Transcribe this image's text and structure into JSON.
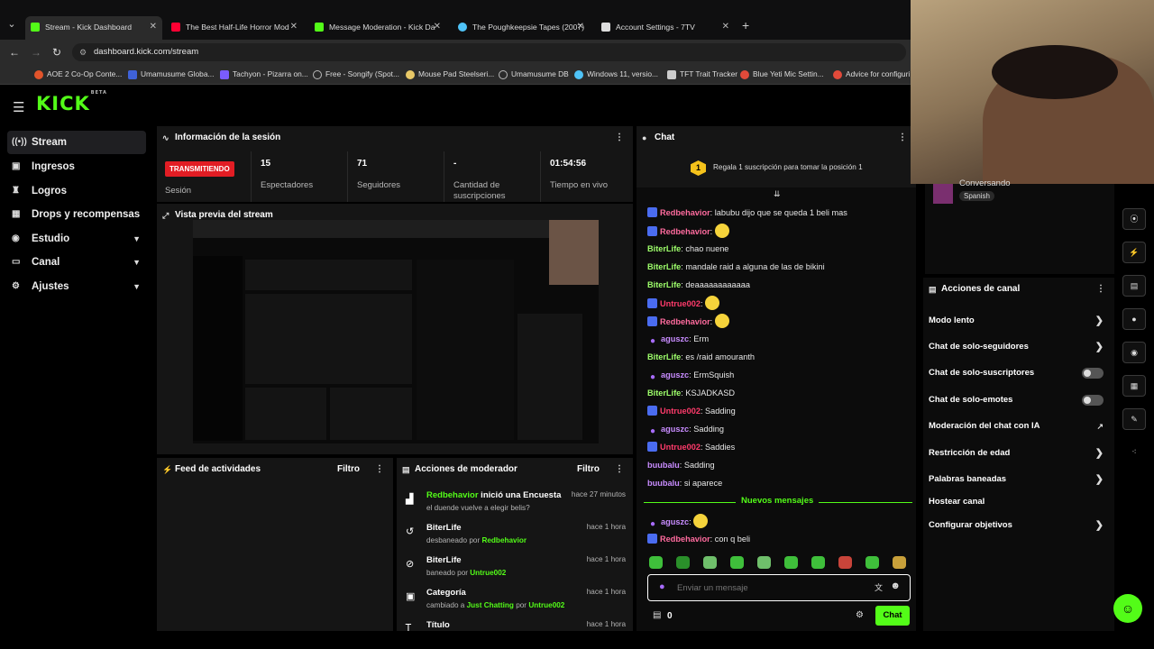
{
  "browser": {
    "tabs": [
      {
        "title": "Stream - Kick Dashboard",
        "color": "#53fc18"
      },
      {
        "title": "The Best Half-Life Horror Mod",
        "color": "#ff0033"
      },
      {
        "title": "Message Moderation - Kick Da",
        "color": "#53fc18"
      },
      {
        "title": "The Poughkeepsie Tapes (2007)",
        "color": "#4fc3f7"
      },
      {
        "title": "Account Settings - 7TV",
        "color": "#dddddd"
      }
    ],
    "url": "dashboard.kick.com/stream",
    "bookmarks": [
      {
        "label": "AOE 2 Co-Op Conte...",
        "color": "#e2542b"
      },
      {
        "label": "Umamusume Globa...",
        "color": "#3f62d8"
      },
      {
        "label": "Tachyon - Pizarra on...",
        "color": "#7a5cff"
      },
      {
        "label": "Free - Songify (Spot...",
        "color": "#bbbbbb"
      },
      {
        "label": "Mouse Pad Steelseri...",
        "color": "#e8c867"
      },
      {
        "label": "Umamusume DB",
        "color": "#bbbbbb"
      },
      {
        "label": "Windows 11, versio...",
        "color": "#4fc3f7"
      },
      {
        "label": "TFT Trait Tracker",
        "color": "#cccccc"
      },
      {
        "label": "Blue Yeti Mic Settin...",
        "color": "#e24a3a"
      },
      {
        "label": "Advice for configuri...",
        "color": "#e24a3a"
      }
    ]
  },
  "brand": {
    "logo": "KICK",
    "beta": "BETA",
    "accent": "#53fc18"
  },
  "sidebar": {
    "items": [
      {
        "label": "Stream",
        "icon": "broadcast-icon"
      },
      {
        "label": "Ingresos",
        "icon": "income-icon"
      },
      {
        "label": "Logros",
        "icon": "trophy-icon"
      },
      {
        "label": "Drops y recompensas",
        "icon": "gift-icon"
      },
      {
        "label": "Estudio",
        "icon": "studio-icon"
      },
      {
        "label": "Canal",
        "icon": "channel-icon"
      },
      {
        "label": "Ajustes",
        "icon": "gear-icon"
      }
    ]
  },
  "session": {
    "title": "Información de la sesión",
    "live_badge": "TRANSMITIENDO",
    "session_label": "Sesión",
    "stats": [
      {
        "value": "15",
        "label": "Espectadores"
      },
      {
        "value": "71",
        "label": "Seguidores"
      },
      {
        "value": "-",
        "label": "Cantidad de suscripciones"
      },
      {
        "value": "01:54:56",
        "label": "Tiempo en vivo"
      }
    ]
  },
  "preview": {
    "title": "Vista previa del stream"
  },
  "feed": {
    "title": "Feed de actividades",
    "filter": "Filtro"
  },
  "modactions": {
    "title": "Acciones de moderador",
    "filter": "Filtro",
    "items": [
      {
        "icon": "chart-icon",
        "title": "Redbehavior",
        "title_suffix": " inició una Encuesta",
        "sub": "el duende vuelve a elegir belis?",
        "time": "hace 27 minutos"
      },
      {
        "icon": "undo-icon",
        "title": "BiterLife",
        "sub_prefix": "desbaneado por ",
        "sub_user": "Redbehavior",
        "time": "hace 1 hora"
      },
      {
        "icon": "ban-icon",
        "title": "BiterLife",
        "sub_prefix": "baneado por ",
        "sub_user": "Untrue002",
        "time": "hace 1 hora"
      },
      {
        "icon": "category-icon",
        "title": "Categoría",
        "sub_prefix": "cambiado a ",
        "sub_user": "Just Chatting",
        "sub_mid": " por ",
        "sub_user2": "Untrue002",
        "time": "hace 1 hora"
      },
      {
        "icon": "title-icon",
        "title": "Título",
        "time": "hace 1 hora"
      }
    ]
  },
  "chat": {
    "title": "Chat",
    "gift_banner": "Regala 1 suscripción para tomar la posición 1",
    "gift_rank": "1",
    "messages": [
      {
        "user": "Redbehavior",
        "color": "#ff6b9e",
        "badge": "mod",
        "text": "labubu dijo que se queda 1 beli mas"
      },
      {
        "user": "Redbehavior",
        "color": "#ff6b9e",
        "badge": "mod",
        "text": "",
        "emote": true
      },
      {
        "user": "BiterLife",
        "color": "#9eff6b",
        "badge": "",
        "text": "chao nuene"
      },
      {
        "user": "BiterLife",
        "color": "#9eff6b",
        "badge": "",
        "text": "mandale raid a alguna de las de bikini"
      },
      {
        "user": "BiterLife",
        "color": "#9eff6b",
        "badge": "",
        "text": "deaaaaaaaaaaaa"
      },
      {
        "user": "Untrue002",
        "color": "#ff3b6b",
        "badge": "mod",
        "text": "",
        "emote": true
      },
      {
        "user": "Redbehavior",
        "color": "#ff6b9e",
        "badge": "mod",
        "text": "",
        "emote": true
      },
      {
        "user": "aguszc",
        "color": "#c88cff",
        "badge": "mic",
        "text": "Erm"
      },
      {
        "user": "BiterLife",
        "color": "#9eff6b",
        "badge": "",
        "text": "es /raid amouranth"
      },
      {
        "user": "aguszc",
        "color": "#c88cff",
        "badge": "mic",
        "text": "ErmSquish"
      },
      {
        "user": "BiterLife",
        "color": "#9eff6b",
        "badge": "",
        "text": "KSJADKASD"
      },
      {
        "user": "Untrue002",
        "color": "#ff3b6b",
        "badge": "mod",
        "text": "Sadding"
      },
      {
        "user": "aguszc",
        "color": "#c88cff",
        "badge": "mic",
        "text": "Sadding"
      },
      {
        "user": "Untrue002",
        "color": "#ff3b6b",
        "badge": "mod",
        "text": "Saddies"
      },
      {
        "user": "buubalu",
        "color": "#c88cff",
        "badge": "",
        "text": "Sadding"
      },
      {
        "user": "buubalu",
        "color": "#c88cff",
        "badge": "",
        "text": "si aparece"
      }
    ],
    "new_divider": "Nuevos mensajes",
    "new_messages": [
      {
        "user": "aguszc",
        "color": "#c88cff",
        "badge": "mic",
        "text": "",
        "emote": true
      },
      {
        "user": "Redbehavior",
        "color": "#ff6b9e",
        "badge": "mod",
        "text": "con q beli"
      }
    ],
    "input_placeholder": "Enviar un mensaje",
    "points": "0",
    "send_label": "Chat"
  },
  "viewer": {
    "status": "Conversando",
    "language": "Spanish"
  },
  "channel_actions": {
    "title": "Acciones de canal",
    "items": [
      {
        "label": "Modo lento",
        "control": "chevron"
      },
      {
        "label": "Chat de solo-seguidores",
        "control": "chevron"
      },
      {
        "label": "Chat de solo-suscriptores",
        "control": "toggle"
      },
      {
        "label": "Chat de solo-emotes",
        "control": "toggle"
      },
      {
        "label": "Moderación del chat con IA",
        "control": "external"
      },
      {
        "label": "Restricción de edad",
        "control": "chevron"
      },
      {
        "label": "Palabras baneadas",
        "control": "chevron"
      },
      {
        "label": "Hostear canal",
        "control": "none"
      },
      {
        "label": "Configurar objetivos",
        "control": "chevron"
      }
    ]
  }
}
